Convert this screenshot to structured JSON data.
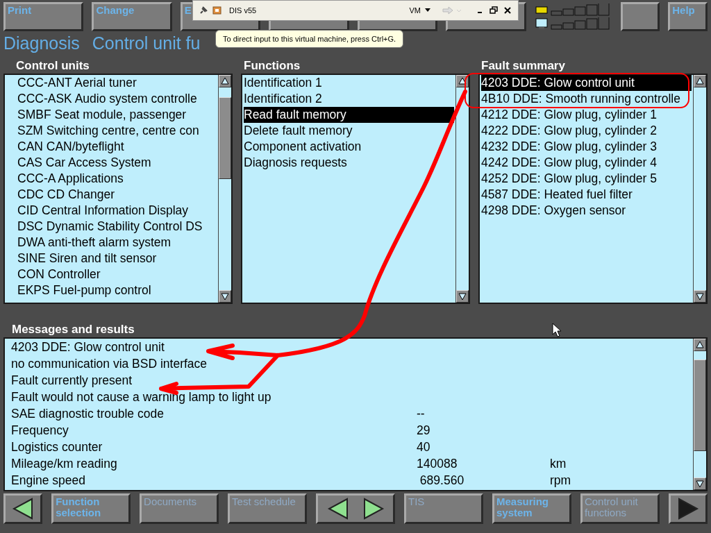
{
  "toolbar": {
    "buttons": [
      {
        "label": "Print"
      },
      {
        "label": "Change"
      },
      {
        "label": "E"
      }
    ],
    "help": "Help"
  },
  "vm_toolbar": {
    "title": "DIS v55",
    "menu": "VM"
  },
  "tooltip": {
    "text": "To direct input to this virtual machine, press Ctrl+G."
  },
  "title": {
    "section": "Diagnosis",
    "page": "Control unit fu"
  },
  "panels": [
    {
      "heading": "Control units",
      "items": [
        {
          "label": "CCC-ANT Aerial tuner",
          "selected": false
        },
        {
          "label": "CCC-ASK Audio system controlle",
          "selected": false
        },
        {
          "label": "SMBF Seat module, passenger",
          "selected": false
        },
        {
          "label": "SZM Switching centre, centre con",
          "selected": false
        },
        {
          "label": "CAN CAN/byteflight",
          "selected": false
        },
        {
          "label": "CAS Car Access System",
          "selected": false
        },
        {
          "label": "CCC-A Applications",
          "selected": false
        },
        {
          "label": "CDC CD Changer",
          "selected": false
        },
        {
          "label": "CID Central Information Display",
          "selected": false
        },
        {
          "label": "DSC Dynamic Stability Control DS",
          "selected": false
        },
        {
          "label": "DWA anti-theft alarm system",
          "selected": false
        },
        {
          "label": "SINE Siren and tilt sensor",
          "selected": false
        },
        {
          "label": "CON Controller",
          "selected": false
        },
        {
          "label": "EKPS Fuel-pump control",
          "selected": false
        }
      ]
    },
    {
      "heading": "Functions",
      "items": [
        {
          "label": "Identification 1",
          "selected": false
        },
        {
          "label": "Identification 2",
          "selected": false
        },
        {
          "label": "Read fault memory",
          "selected": true
        },
        {
          "label": "Delete fault memory",
          "selected": false
        },
        {
          "label": "Component activation",
          "selected": false
        },
        {
          "label": "Diagnosis requests",
          "selected": false
        }
      ]
    },
    {
      "heading": "Fault summary",
      "items": [
        {
          "label": "4203 DDE: Glow control unit",
          "selected": true
        },
        {
          "label": "4B10 DDE: Smooth running controlle",
          "selected": false
        },
        {
          "label": "4212 DDE: Glow plug, cylinder 1",
          "selected": false
        },
        {
          "label": "4222 DDE: Glow plug, cylinder 2",
          "selected": false
        },
        {
          "label": "4232 DDE: Glow plug, cylinder 3",
          "selected": false
        },
        {
          "label": "4242 DDE: Glow plug, cylinder 4",
          "selected": false
        },
        {
          "label": "4252 DDE: Glow plug, cylinder 5",
          "selected": false
        },
        {
          "label": "4587 DDE: Heated fuel filter",
          "selected": false
        },
        {
          "label": "4298 DDE: Oxygen sensor",
          "selected": false
        }
      ]
    }
  ],
  "messages": {
    "heading": "Messages and results",
    "rows": [
      {
        "text": "4203 DDE: Glow control unit"
      },
      {
        "text": "no communication via BSD interface"
      },
      {
        "text": "Fault currently present"
      },
      {
        "text": "Fault would not cause a warning lamp to light up"
      },
      {
        "text": "SAE diagnostic trouble code",
        "value": "--"
      },
      {
        "text": "Frequency",
        "value": "29"
      },
      {
        "text": "Logistics counter",
        "value": "40"
      },
      {
        "text": "Mileage/km reading",
        "value": "140088",
        "unit": "km"
      },
      {
        "text": "Engine speed",
        "value": " 689.560",
        "unit": "rpm"
      }
    ]
  },
  "bottom_bar": [
    {
      "kind": "arrow_left"
    },
    {
      "kind": "text",
      "label": "Function selection",
      "disabled": false
    },
    {
      "kind": "text",
      "label": "Documents",
      "disabled": true
    },
    {
      "kind": "text",
      "label": "Test schedule",
      "disabled": true
    },
    {
      "kind": "arrows"
    },
    {
      "kind": "text",
      "label": "TIS",
      "disabled": true
    },
    {
      "kind": "text",
      "label": "Measuring system",
      "disabled": false
    },
    {
      "kind": "text",
      "label": "Control unit functions",
      "disabled": true
    },
    {
      "kind": "arrow_right"
    }
  ]
}
